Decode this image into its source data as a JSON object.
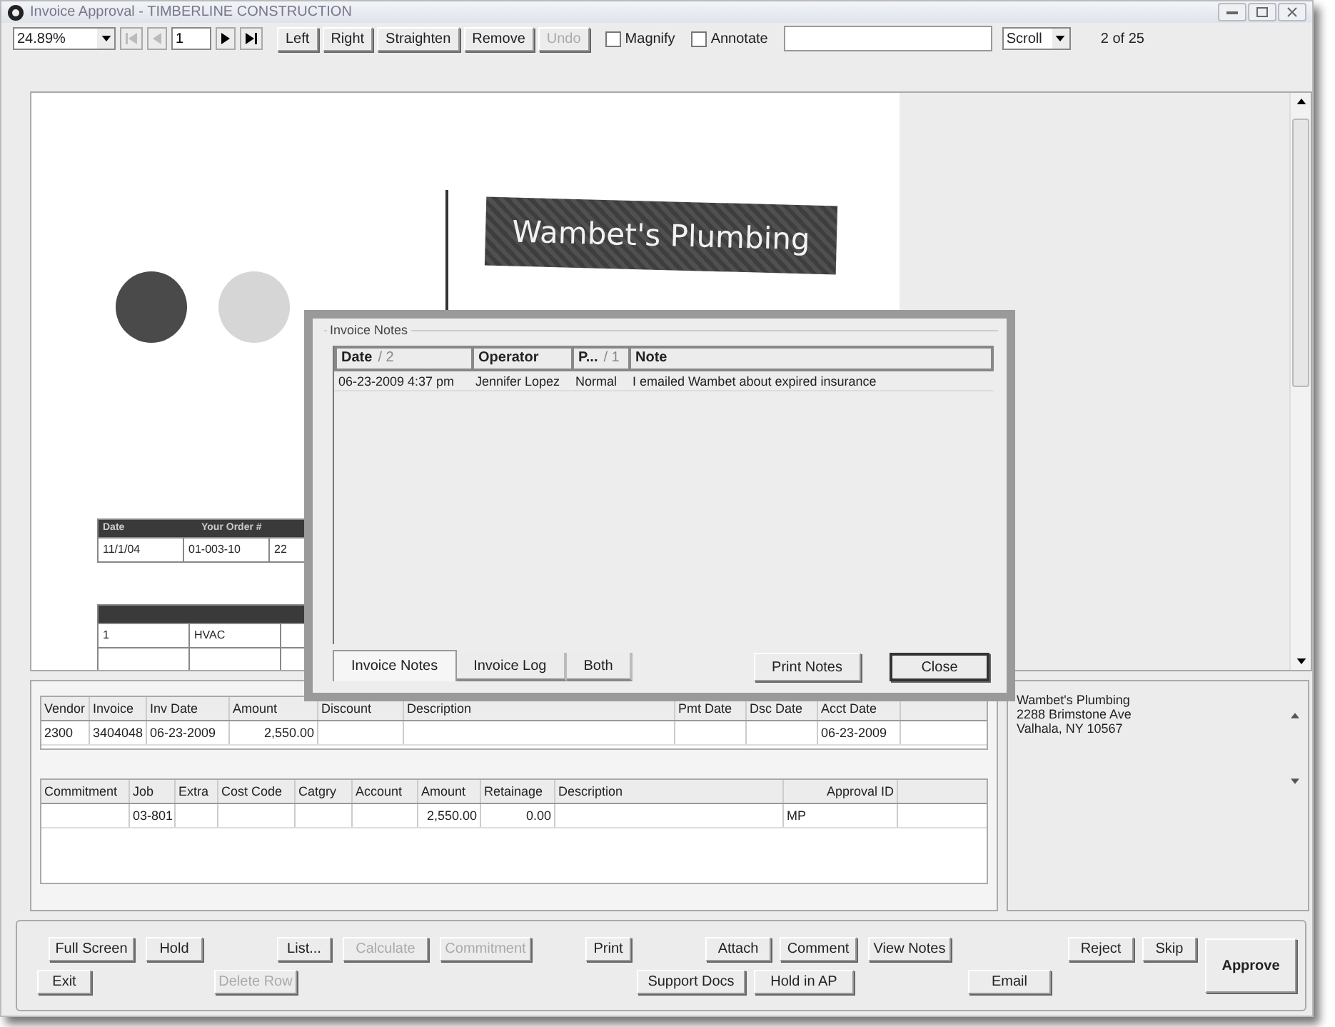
{
  "window": {
    "title": "Invoice Approval - TIMBERLINE CONSTRUCTION"
  },
  "toolbar": {
    "zoom": "24.89%",
    "nav": [
      {
        "kind": "first",
        "disabled": true
      },
      {
        "kind": "prev",
        "disabled": true
      },
      {
        "kind": "page",
        "value": "1"
      },
      {
        "kind": "next",
        "disabled": false
      },
      {
        "kind": "last",
        "disabled": false
      }
    ],
    "buttons": [
      {
        "label": "Left",
        "disabled": false
      },
      {
        "label": "Right",
        "disabled": false
      },
      {
        "label": "Straighten",
        "disabled": false
      },
      {
        "label": "Remove",
        "disabled": false
      },
      {
        "label": "Undo",
        "disabled": true
      }
    ],
    "checkboxes": [
      {
        "label": "Magnify",
        "checked": false
      },
      {
        "label": "Annotate",
        "checked": false
      }
    ],
    "mode": "Scroll",
    "page_count": "2 of 25"
  },
  "document": {
    "company": "Wambet's Plumbing",
    "tables": [
      {
        "headers": [
          "Date",
          "Your Order #"
        ],
        "rows": [
          [
            "11/1/04",
            "01-003-10",
            "22"
          ]
        ]
      },
      {
        "rows": [
          [
            "1",
            "HVAC"
          ],
          [
            null,
            null
          ]
        ]
      }
    ]
  },
  "notes_dialog": {
    "group": "Invoice Notes",
    "columns": [
      {
        "label": "Date",
        "sort": "/ 2"
      },
      {
        "label": "Operator"
      },
      {
        "label": "P...",
        "sort": "/ 1"
      },
      {
        "label": "Note"
      }
    ],
    "rows": [
      [
        "06-23-2009 4:37 pm",
        "Jennifer Lopez",
        "Normal",
        "I emailed Wambet about expired insurance"
      ]
    ],
    "tabs": [
      {
        "label": "Invoice Notes",
        "selected": true
      },
      {
        "label": "Invoice Log",
        "selected": false
      },
      {
        "label": "Both",
        "selected": false
      }
    ],
    "buttons": [
      {
        "label": "Print Notes",
        "default": false
      },
      {
        "label": "Close",
        "default": true
      }
    ]
  },
  "invoice_grid": {
    "columns": [
      "Vendor",
      "Invoice",
      "Inv Date",
      "Amount",
      "Discount",
      "Description",
      "Pmt Date",
      "Dsc Date",
      "Acct Date"
    ],
    "rows": [
      [
        "2300",
        "3404048",
        "06-23-2009",
        "2,550.00",
        null,
        null,
        null,
        null,
        "06-23-2009"
      ]
    ]
  },
  "distribution_grid": {
    "columns": [
      "Commitment",
      "Job",
      "Extra",
      "Cost Code",
      "Catgry",
      "Account",
      "Amount",
      "Retainage",
      "Description",
      "Approval ID"
    ],
    "rows": [
      [
        null,
        "03-801",
        null,
        null,
        null,
        null,
        "2,550.00",
        "0.00",
        null,
        "MP"
      ]
    ]
  },
  "vendor_address": [
    "Wambet's Plumbing",
    "2288 Brimstone Ave",
    "Valhala, NY 10567"
  ],
  "actions": [
    [
      {
        "label": "Full Screen",
        "disabled": false
      },
      {
        "label": "Hold",
        "disabled": false
      },
      {
        "label": "List...",
        "disabled": false
      },
      {
        "label": "Calculate",
        "disabled": true
      },
      {
        "label": "Commitment",
        "disabled": true
      },
      {
        "label": "Print",
        "disabled": false
      },
      {
        "label": "Attach",
        "disabled": false
      },
      {
        "label": "Comment",
        "disabled": false
      },
      {
        "label": "View Notes",
        "disabled": false
      },
      {
        "label": "Reject",
        "disabled": false
      },
      {
        "label": "Skip",
        "disabled": false
      }
    ],
    [
      {
        "label": "Exit",
        "disabled": false
      },
      {
        "label": "Delete Row",
        "disabled": true
      },
      {
        "label": "Support Docs",
        "disabled": false
      },
      {
        "label": "Hold in AP",
        "disabled": false
      },
      {
        "label": "Email",
        "disabled": false
      }
    ]
  ],
  "approve": "Approve"
}
